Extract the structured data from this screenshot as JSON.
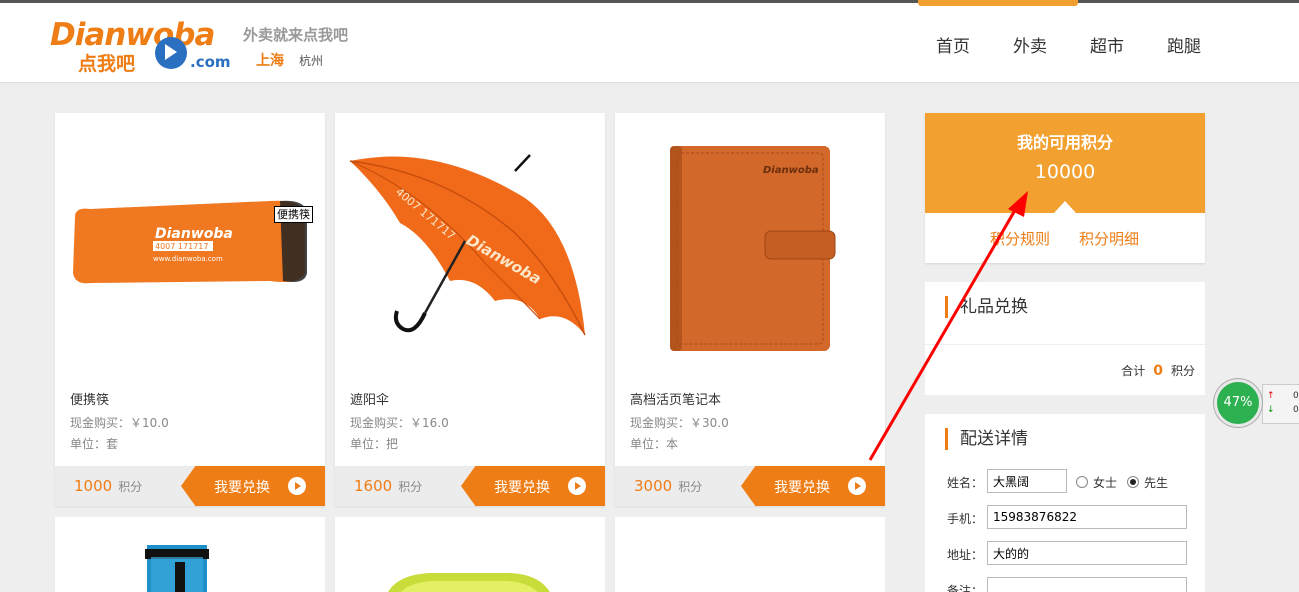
{
  "header": {
    "logo_text": "Dianwoba",
    "logo_sub": "点我吧",
    "logo_com": ".com",
    "slogan": "外卖就来点我吧",
    "city_active": "上海",
    "city_other": "杭州",
    "nav": [
      "首页",
      "外卖",
      "超市",
      "跑腿"
    ]
  },
  "products": [
    {
      "name": "便携筷",
      "price": "现金购买：￥10.0",
      "unit": "单位：套",
      "points": "1000",
      "points_unit": "积分",
      "button": "我要兑换"
    },
    {
      "name": "遮阳伞",
      "price": "现金购买：￥16.0",
      "unit": "单位：把",
      "points": "1600",
      "points_unit": "积分",
      "button": "我要兑换"
    },
    {
      "name": "高档活页笔记本",
      "price": "现金购买：￥30.0",
      "unit": "单位：本",
      "points": "3000",
      "points_unit": "积分",
      "button": "我要兑换"
    }
  ],
  "product_images": {
    "item1_text1": "Dianwoba",
    "item1_text2": "4007 171717",
    "item1_text3": "www.dianwoba.com",
    "item2_text1": "Dianwoba",
    "item2_text2": "4007 171717",
    "item3_text1": "Dianwoba"
  },
  "tooltip": "便携筷",
  "sidebar": {
    "points_title": "我的可用积分",
    "points_value": "10000",
    "links": [
      "积分规则",
      "积分明细"
    ],
    "gift_title": "礼品兑换",
    "total_label": "合计",
    "total_value": "0",
    "total_unit": "积分",
    "delivery_title": "配送详情",
    "name_label": "姓名：",
    "name_value": "大黑阔",
    "gender_female": "女士",
    "gender_male": "先生",
    "phone_label": "手机：",
    "phone_value": "15983876822",
    "address_label": "地址：",
    "address_value": "大的的",
    "note_label": "备注："
  },
  "widget": {
    "percent": "47%",
    "up_icon": "arrow-up-icon",
    "down_icon": "arrow-down-icon",
    "val1": "0",
    "val2": "0"
  },
  "colors": {
    "accent": "#ef7d15",
    "points_bg": "#f2a030",
    "annotation": "#ff0000"
  }
}
